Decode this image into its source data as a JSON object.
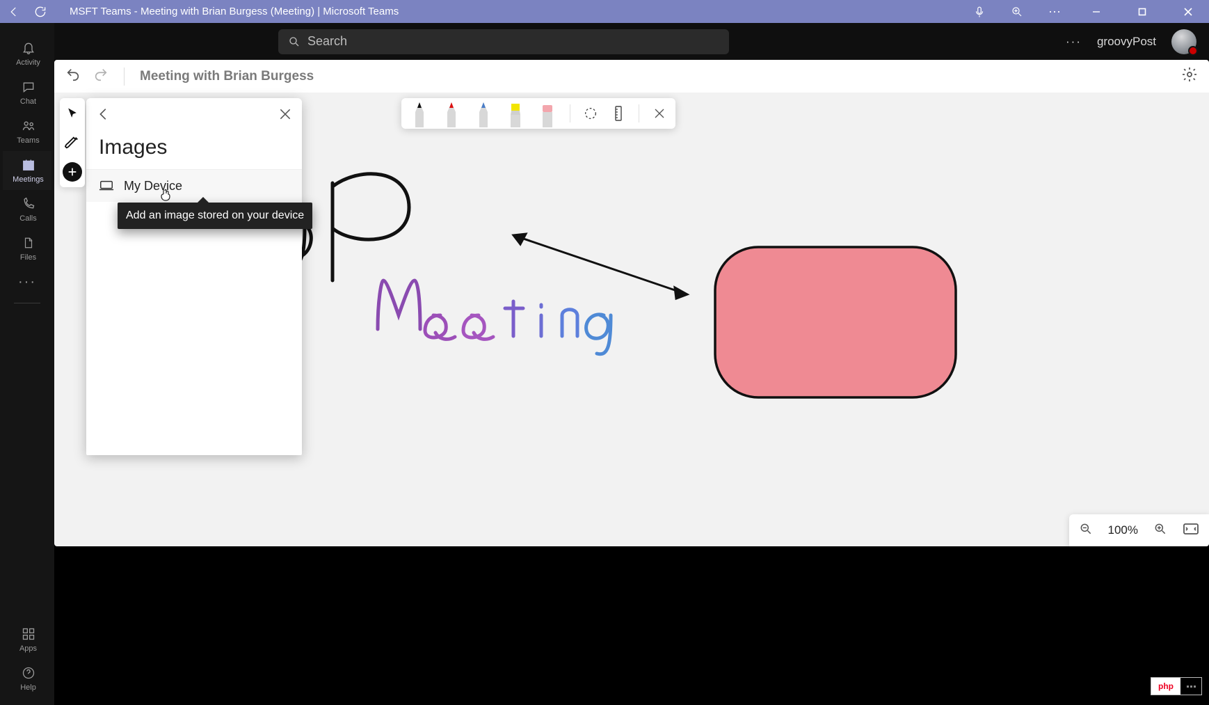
{
  "titlebar": {
    "title": "MSFT Teams - Meeting with Brian Burgess (Meeting) | Microsoft Teams"
  },
  "topbar": {
    "search_placeholder": "Search",
    "more_label": "···",
    "username": "groovyPost"
  },
  "rail": {
    "activity": "Activity",
    "chat": "Chat",
    "teams": "Teams",
    "meetings": "Meetings",
    "calls": "Calls",
    "files": "Files",
    "apps": "Apps",
    "help": "Help"
  },
  "whiteboard": {
    "title": "Meeting with Brian Burgess",
    "panel": {
      "title": "Images",
      "mydevice": "My Device",
      "tooltip": "Add an image stored on your device"
    },
    "zoom": {
      "level": "100%"
    }
  },
  "badge": {
    "left": "php"
  },
  "colors": {
    "titlebar": "#7b83c1",
    "shape_fill": "#ef8a93"
  }
}
